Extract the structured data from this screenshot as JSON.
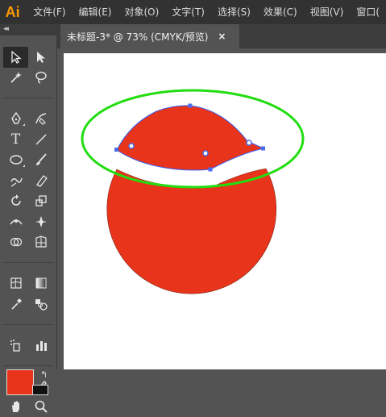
{
  "app": {
    "logo_text": "Ai"
  },
  "menu": {
    "items": [
      {
        "label": "文件(F)"
      },
      {
        "label": "编辑(E)"
      },
      {
        "label": "对象(O)"
      },
      {
        "label": "文字(T)"
      },
      {
        "label": "选择(S)"
      },
      {
        "label": "效果(C)"
      },
      {
        "label": "视图(V)"
      },
      {
        "label": "窗口("
      }
    ]
  },
  "document": {
    "tab_title": "未标题-3* @ 73% (CMYK/预览)",
    "close_glyph": "×"
  },
  "tools": {
    "collapse_glyph": "◂◂",
    "type_tool_glyph": "T",
    "swap_glyph": "↰"
  },
  "colors": {
    "fill": "#e8341a",
    "stroke": "#111111",
    "shape_red": "#e8341a",
    "highlight_green": "#22dd11",
    "selection_blue": "#4a6cf0"
  }
}
